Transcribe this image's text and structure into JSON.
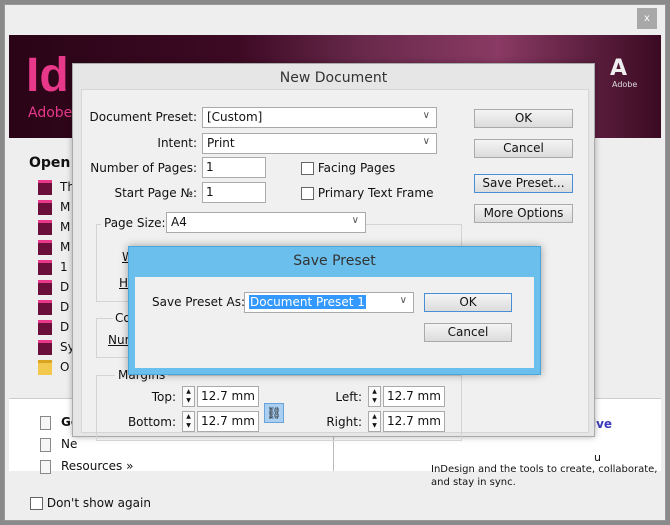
{
  "welcome": {
    "close_label": "x",
    "logo": "Id",
    "brand": "Adobe",
    "adobe_corner": "Adobe",
    "open_heading": "Open a",
    "recent_files": [
      {
        "label": "Th",
        "icon": "indesign-file-icon"
      },
      {
        "label": "M",
        "icon": "indesign-file-icon"
      },
      {
        "label": "M",
        "icon": "indesign-file-icon"
      },
      {
        "label": "M",
        "icon": "indesign-file-icon"
      },
      {
        "label": "1",
        "icon": "indesign-file-icon"
      },
      {
        "label": "D",
        "icon": "indesign-file-icon"
      },
      {
        "label": "D",
        "icon": "indesign-file-icon"
      },
      {
        "label": "D",
        "icon": "indesign-file-icon"
      },
      {
        "label": "Sy",
        "icon": "indesign-file-icon"
      },
      {
        "label": "O",
        "icon": "folder-icon"
      }
    ],
    "links": [
      "Ge",
      "Ne",
      "Resources »"
    ],
    "promo_title": "ive",
    "promo_line0": "u",
    "promo_line1": "InDesign and the tools to create, collaborate,",
    "promo_line2": "and stay in sync.",
    "dont_show": "Don't show again"
  },
  "new_document": {
    "title": "New Document",
    "preset_label": "Document Preset:",
    "preset_value": "[Custom]",
    "intent_label": "Intent:",
    "intent_value": "Print",
    "pages_label": "Number of Pages:",
    "pages_value": "1",
    "start_label": "Start Page №:",
    "start_value": "1",
    "facing_label": "Facing Pages",
    "facing_checked": false,
    "primary_label": "Primary Text Frame",
    "primary_checked": false,
    "ok": "OK",
    "cancel": "Cancel",
    "save_preset": "Save Preset...",
    "more_options": "More Options",
    "page_size_label": "Page Size:",
    "page_size_value": "A4",
    "width_partial": "W",
    "height_partial": "H",
    "columns_partial": "Co",
    "number_partial": "Num",
    "margins_label": "Margins",
    "top_label": "Top:",
    "top_value": "12.7 mm",
    "bottom_label": "Bottom:",
    "bottom_value": "12.7 mm",
    "left_label": "Left:",
    "left_value": "12.7 mm",
    "right_label": "Right:",
    "right_value": "12.7 mm"
  },
  "save_preset": {
    "title": "Save Preset",
    "label": "Save Preset As:",
    "value": "Document Preset 1",
    "ok": "OK",
    "cancel": "Cancel",
    "title_bar_color": "#6bbfec"
  }
}
